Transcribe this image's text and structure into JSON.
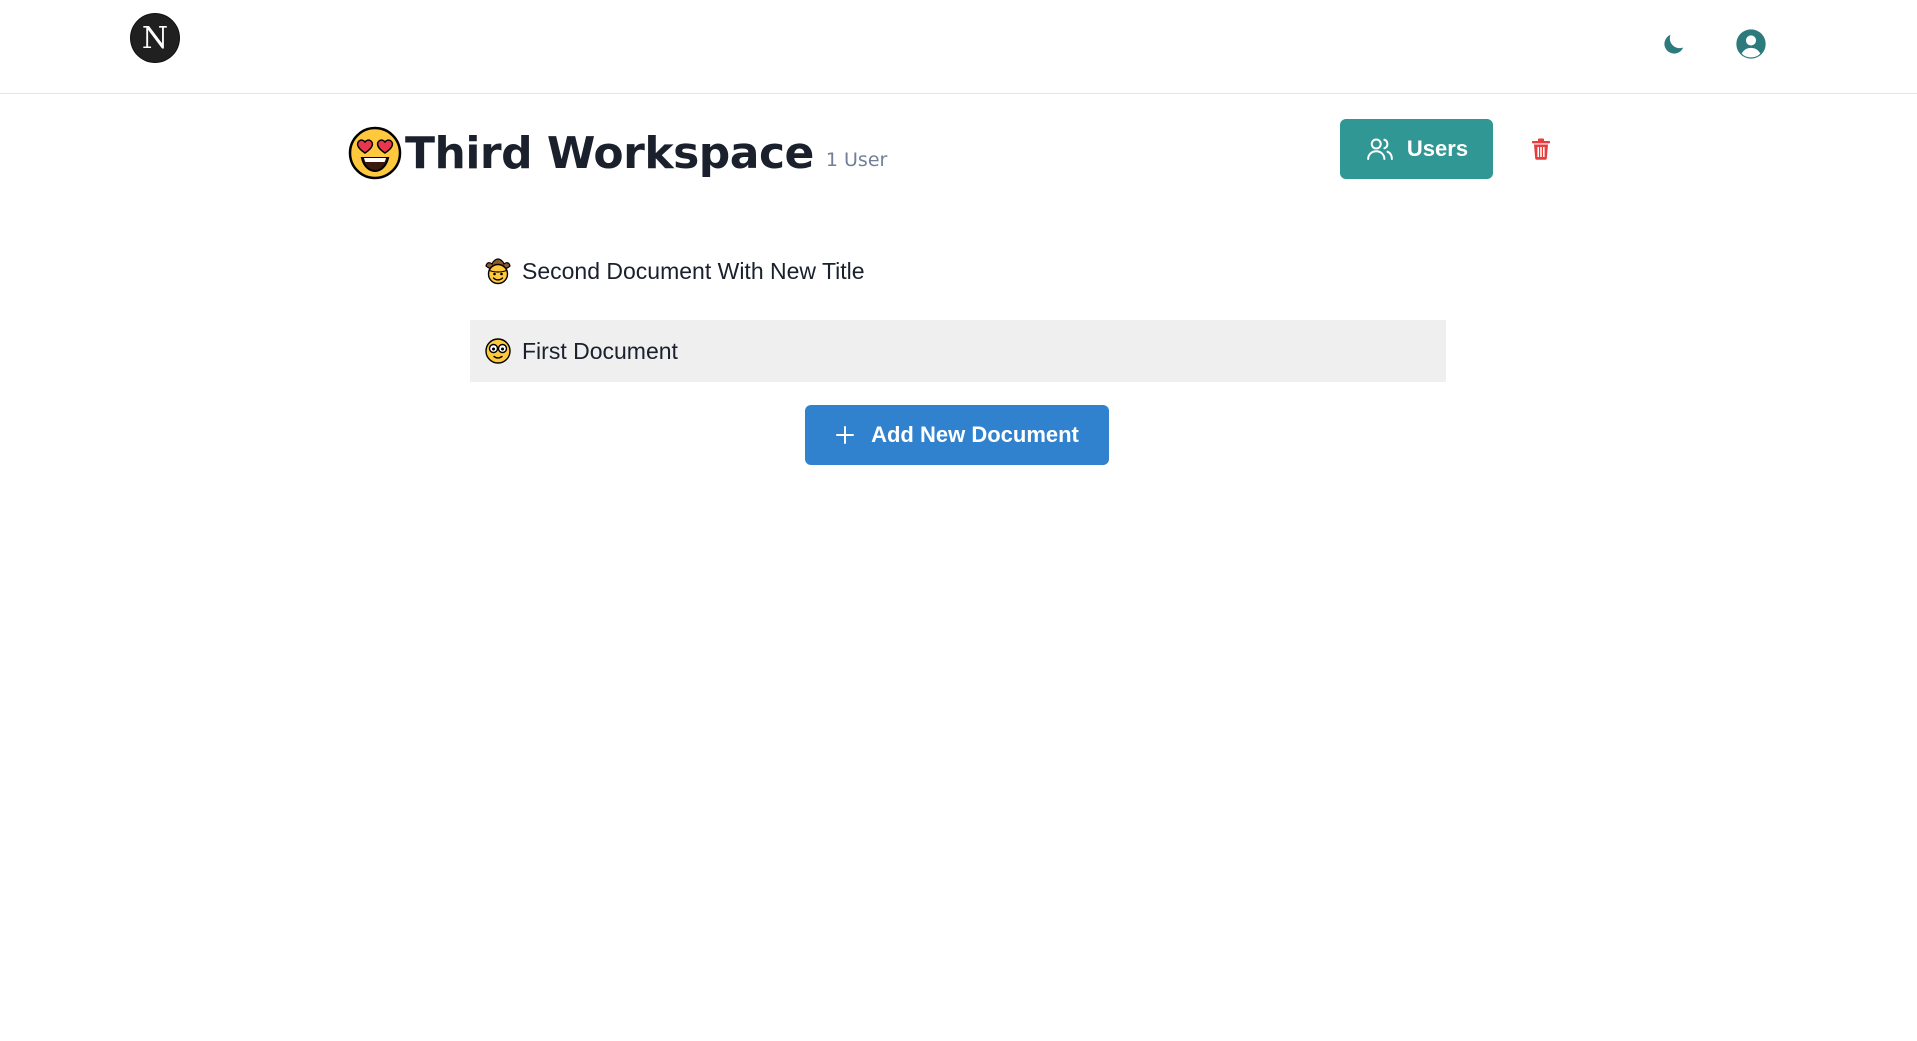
{
  "nav": {
    "logo_letter": "N",
    "icons": {
      "theme": "moon-icon",
      "account": "user-circle-icon"
    },
    "accent_color": "#2c7a7b"
  },
  "workspace": {
    "emoji": "heart-eyes-face-icon",
    "title": "Third Workspace",
    "user_count": "1 User",
    "users_button_label": "Users",
    "users_button_color": "#319795",
    "delete_icon": "trash-icon",
    "delete_color": "#e53e3e"
  },
  "documents": [
    {
      "emoji": "cowboy-face-icon",
      "title": "Second Document With New Title",
      "active": false
    },
    {
      "emoji": "goggle-face-icon",
      "title": "First Document",
      "active": true
    }
  ],
  "add_document": {
    "label": "Add New Document",
    "icon": "plus-icon",
    "color": "#3182ce"
  }
}
